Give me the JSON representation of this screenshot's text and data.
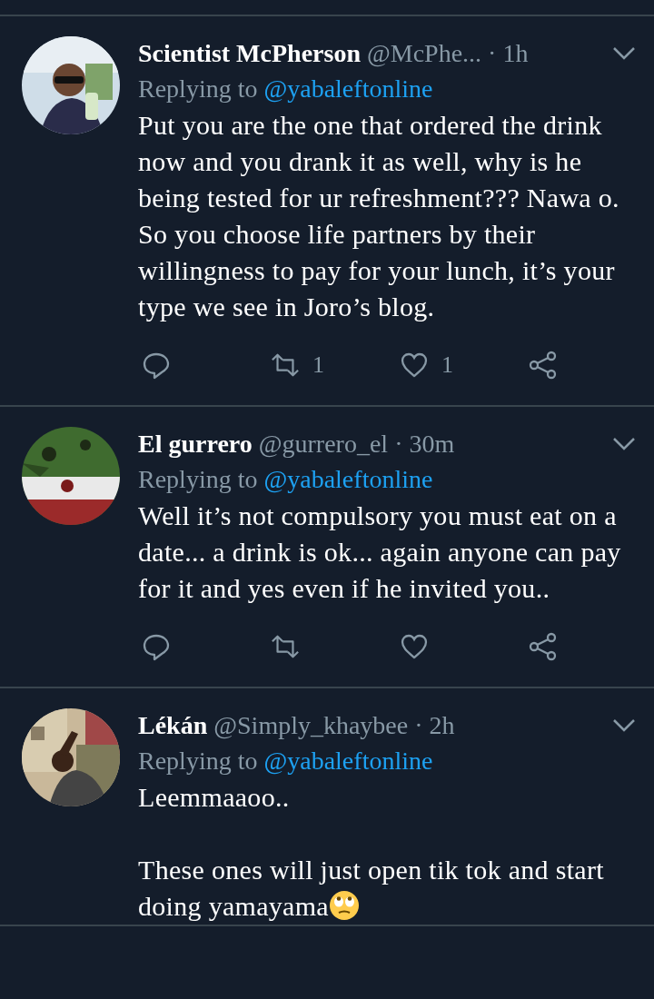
{
  "tweets": [
    {
      "name": "Scientist McPherson",
      "handle": "@McPhe...",
      "time": "· 1h",
      "replying_prefix": "Replying to",
      "replying_to": "@yabaleftonline",
      "body": "Put you are the one that ordered the drink now and you drank it as well, why is he being tested for ur refreshment??? Nawa o.\nSo you choose life partners by their willingness to pay for your lunch, it’s your type we see in Joro’s blog.",
      "emoji": false,
      "actions": [
        {
          "kind": "reply"
        },
        {
          "kind": "retweet",
          "count": "1"
        },
        {
          "kind": "like",
          "count": "1"
        },
        {
          "kind": "share"
        }
      ]
    },
    {
      "name": "El gurrero",
      "handle": "@gurrero_el",
      "time": "· 30m",
      "replying_prefix": "Replying to",
      "replying_to": "@yabaleftonline",
      "body": "Well it’s not compulsory you must eat on a date... a drink is ok... again anyone can pay for it and yes even if he invited you..",
      "emoji": false,
      "actions": [
        {
          "kind": "reply"
        },
        {
          "kind": "retweet"
        },
        {
          "kind": "like"
        },
        {
          "kind": "share"
        }
      ]
    },
    {
      "name": "Lékán",
      "handle": "@Simply_khaybee",
      "time": "· 2h",
      "replying_prefix": "Replying to",
      "replying_to": "@yabaleftonline",
      "body": "Leemmaaoo..\n\nThese ones will just open tik tok and start doing yamayama",
      "emoji": true
    }
  ]
}
